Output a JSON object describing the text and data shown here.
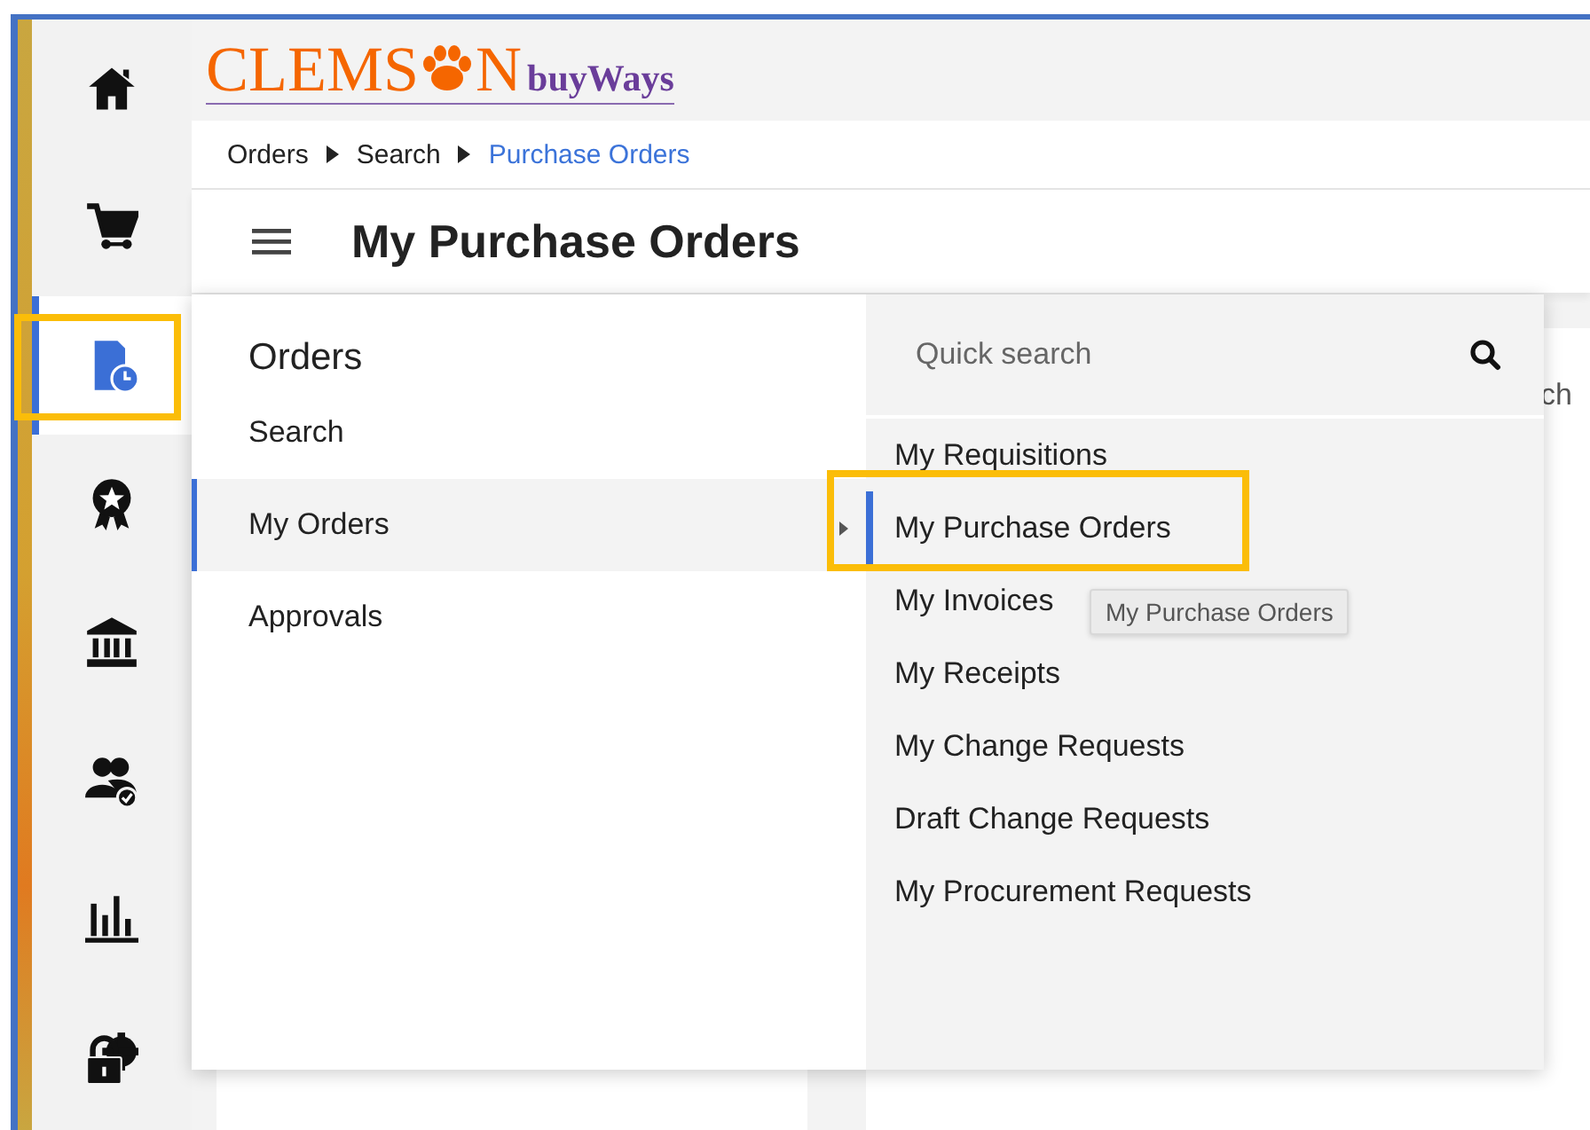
{
  "logo": {
    "before": "CLEMS",
    "after": "N",
    "suffix": "buyWays"
  },
  "sidebar": {
    "items": [
      {
        "kind": "home",
        "selected": false,
        "highlighted": false
      },
      {
        "kind": "cart",
        "selected": false,
        "highlighted": false
      },
      {
        "kind": "orders",
        "selected": true,
        "highlighted": true
      },
      {
        "kind": "award",
        "selected": false,
        "highlighted": false
      },
      {
        "kind": "bank",
        "selected": false,
        "highlighted": false
      },
      {
        "kind": "people",
        "selected": false,
        "highlighted": false
      },
      {
        "kind": "chart",
        "selected": false,
        "highlighted": false
      },
      {
        "kind": "lock",
        "selected": false,
        "highlighted": false
      }
    ]
  },
  "breadcrumb": [
    {
      "label": "Orders",
      "current": false
    },
    {
      "label": "Search",
      "current": false
    },
    {
      "label": "Purchase Orders",
      "current": true
    }
  ],
  "page_title": "My Purchase Orders",
  "background_field": {
    "value": "ch"
  },
  "menu": {
    "title": "Orders",
    "items": [
      {
        "label": "Search",
        "selected": false
      },
      {
        "label": "My Orders",
        "selected": true
      },
      {
        "label": "Approvals",
        "selected": false
      }
    ],
    "submenu": {
      "placeholder": "Quick search",
      "items": [
        {
          "label": "My Requisitions",
          "selected": false,
          "highlighted": false
        },
        {
          "label": "My Purchase Orders",
          "selected": true,
          "highlighted": true
        },
        {
          "label": "My Invoices",
          "selected": false,
          "highlighted": false
        },
        {
          "label": "My Receipts",
          "selected": false,
          "highlighted": false
        },
        {
          "label": "My Change Requests",
          "selected": false,
          "highlighted": false
        },
        {
          "label": "Draft Change Requests",
          "selected": false,
          "highlighted": false
        },
        {
          "label": "My Procurement Requests",
          "selected": false,
          "highlighted": false
        }
      ]
    }
  },
  "tooltip": "My Purchase Orders"
}
